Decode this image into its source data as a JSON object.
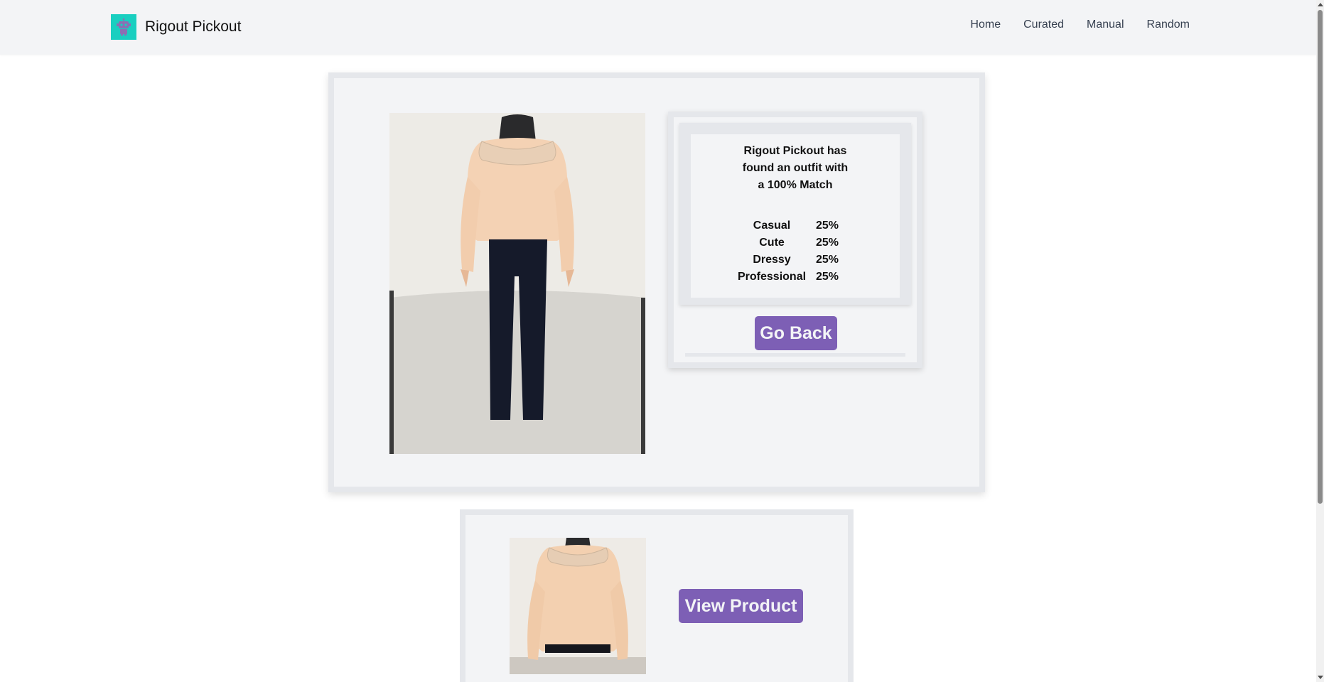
{
  "navbar": {
    "brand": "Rigout Pickout",
    "links": [
      "Home",
      "Curated",
      "Manual",
      "Random"
    ]
  },
  "result": {
    "match_lines": [
      "Rigout Pickout has",
      "found an outfit with",
      "a 100% Match"
    ],
    "scores": [
      {
        "label": "Casual",
        "value": "25%"
      },
      {
        "label": "Cute",
        "value": "25%"
      },
      {
        "label": "Dressy",
        "value": "25%"
      },
      {
        "label": "Professional",
        "value": "25%"
      }
    ],
    "go_back_label": "Go Back"
  },
  "product": {
    "view_label": "View Product"
  },
  "colors": {
    "accent": "#7d5fb5",
    "logo_bg": "#19cfc0",
    "panel_bg": "#f3f4f6",
    "panel_border": "#e5e7eb"
  },
  "icons": {
    "logo": "robot-logo-icon"
  }
}
